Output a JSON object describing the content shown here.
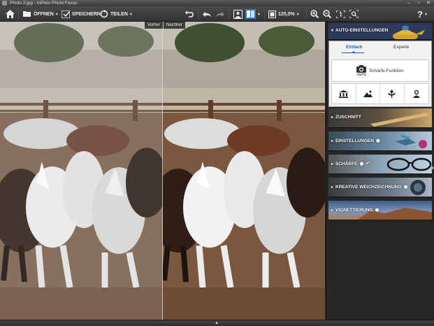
{
  "window": {
    "title": "Photo 2.jpg - InPixio Photo Focus",
    "controls": {
      "minimize": "–",
      "maximize": "▫",
      "close": "✕"
    }
  },
  "toolbar": {
    "open_label": "ÖFFNEN",
    "save_label": "SPEICHERN",
    "share_label": "TEILEN",
    "zoom_value": "125,0%",
    "help_label": "?",
    "caret": "▾"
  },
  "canvas": {
    "before_label": "Vorher",
    "after_label": "Nachher"
  },
  "panel": {
    "auto_settings_label": "AUTO-EINSTELLUNGEN",
    "tabs": [
      {
        "label": "Einfach",
        "active": true
      },
      {
        "label": "Experte",
        "active": false
      }
    ],
    "sharpness_function_label": "Schärfe-Funktion",
    "auto_badge": "AUTO",
    "presets": [
      "building-icon",
      "landscape-icon",
      "flower-icon",
      "portrait-icon"
    ],
    "sections": [
      {
        "label": "ZUSCHNITT",
        "eye": false,
        "undo": false
      },
      {
        "label": "EINSTELLUNGEN",
        "eye": true,
        "undo": false
      },
      {
        "label": "SCHÄRFE",
        "eye": true,
        "undo": true
      },
      {
        "label": "KREATIVE WEICHZEICHNUNG",
        "eye": true,
        "undo": false
      },
      {
        "label": "VIGNETTIERUNG",
        "eye": true,
        "undo": false
      }
    ]
  },
  "colors": {
    "accent": "#1a5ea8",
    "toolbar_bg": "#3e3e3e",
    "panel_bg": "#262626"
  }
}
